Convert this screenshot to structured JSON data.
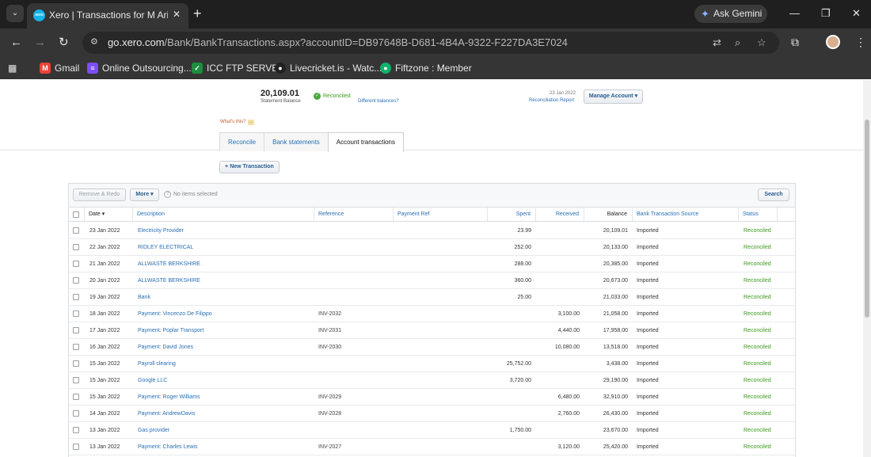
{
  "browser": {
    "tab_title": "Xero | Transactions for M Arif Ali",
    "favicon_text": "xero",
    "gemini_label": "Ask Gemini",
    "url_host": "go.xero.com",
    "url_path": "/Bank/BankTransactions.aspx?accountID=DB97648B-D681-4B4A-9322-F227DA3E7024",
    "bookmarks": [
      {
        "label": "Gmail",
        "icon": "gmail-icon",
        "color": "#ea4335",
        "glyph": "M"
      },
      {
        "label": "Online Outsourcing...",
        "icon": "list-icon",
        "color": "#7c4dff",
        "glyph": "≡"
      },
      {
        "label": "ICC FTP SERVER",
        "icon": "check-icon",
        "color": "#1e8e3e",
        "glyph": "✓"
      },
      {
        "label": "Livecricket.is - Watc...",
        "icon": "cricket-icon",
        "color": "#222222",
        "glyph": "●"
      },
      {
        "label": "Fiftzone : Member",
        "icon": "fiftzone-icon",
        "color": "#0fb36b",
        "glyph": "●"
      }
    ]
  },
  "summary": {
    "statement_balance": "20,109.01",
    "statement_balance_label": "Statement Balance",
    "reconciled_label": "Reconciled",
    "different_balances": "Different balances?",
    "report_date": "23 Jan 2022",
    "reconciliation_report": "Reconciliation Report",
    "manage_account": "Manage Account ▾",
    "whats_this": "What's this?"
  },
  "tabs": [
    "Reconcile",
    "Bank statements",
    "Account transactions"
  ],
  "new_transaction": "+ New Transaction",
  "toolbar": {
    "remove_redo": "Remove & Redo",
    "more": "More ▾",
    "no_items": "No items selected",
    "search": "Search"
  },
  "columns": {
    "date": "Date ▾",
    "description": "Description",
    "reference": "Reference",
    "payment_ref": "Payment Ref",
    "spent": "Spent",
    "received": "Received",
    "balance": "Balance",
    "source": "Bank Transaction Source",
    "status": "Status"
  },
  "rows": [
    {
      "date": "23 Jan 2022",
      "description": "Electricity Provider",
      "reference": "",
      "spent": "23.99",
      "received": "",
      "balance": "20,109.01",
      "source": "Imported",
      "status": "Reconciled"
    },
    {
      "date": "22 Jan 2022",
      "description": "RIDLEY ELECTRICAL",
      "reference": "",
      "spent": "252.00",
      "received": "",
      "balance": "20,133.00",
      "source": "Imported",
      "status": "Reconciled"
    },
    {
      "date": "21 Jan 2022",
      "description": "ALLWASTE BERKSHIRE",
      "reference": "",
      "spent": "288.00",
      "received": "",
      "balance": "20,385.00",
      "source": "Imported",
      "status": "Reconciled"
    },
    {
      "date": "20 Jan 2022",
      "description": "ALLWASTE BERKSHIRE",
      "reference": "",
      "spent": "360.00",
      "received": "",
      "balance": "20,673.00",
      "source": "Imported",
      "status": "Reconciled"
    },
    {
      "date": "19 Jan 2022",
      "description": "Bank",
      "reference": "",
      "spent": "25.00",
      "received": "",
      "balance": "21,033.00",
      "source": "Imported",
      "status": "Reconciled"
    },
    {
      "date": "18 Jan 2022",
      "description": "Payment: Vincenzo De Filippo",
      "reference": "INV-2032",
      "spent": "",
      "received": "3,100.00",
      "balance": "21,058.00",
      "source": "Imported",
      "status": "Reconciled"
    },
    {
      "date": "17 Jan 2022",
      "description": "Payment: Poplar Transport",
      "reference": "INV-2031",
      "spent": "",
      "received": "4,440.00",
      "balance": "17,958.00",
      "source": "Imported",
      "status": "Reconciled"
    },
    {
      "date": "16 Jan 2022",
      "description": "Payment: David Jones",
      "reference": "INV-2030",
      "spent": "",
      "received": "10,080.00",
      "balance": "13,518.00",
      "source": "Imported",
      "status": "Reconciled"
    },
    {
      "date": "15 Jan 2022",
      "description": "Payroll clearing",
      "reference": "",
      "spent": "25,752.00",
      "received": "",
      "balance": "3,438.00",
      "source": "Imported",
      "status": "Reconciled"
    },
    {
      "date": "15 Jan 2022",
      "description": "Google LLC",
      "reference": "",
      "spent": "3,720.00",
      "received": "",
      "balance": "29,190.00",
      "source": "Imported",
      "status": "Reconciled"
    },
    {
      "date": "15 Jan 2022",
      "description": "Payment: Roger Williams",
      "reference": "INV-2029",
      "spent": "",
      "received": "6,480.00",
      "balance": "32,910.00",
      "source": "Imported",
      "status": "Reconciled"
    },
    {
      "date": "14 Jan 2022",
      "description": "Payment: AndrewDavis",
      "reference": "INV-2028",
      "spent": "",
      "received": "2,760.00",
      "balance": "26,430.00",
      "source": "Imported",
      "status": "Reconciled"
    },
    {
      "date": "13 Jan 2022",
      "description": "Gas provider",
      "reference": "",
      "spent": "1,750.00",
      "received": "",
      "balance": "23,670.00",
      "source": "Imported",
      "status": "Reconciled"
    },
    {
      "date": "13 Jan 2022",
      "description": "Payment: Charles Lewis",
      "reference": "INV-2027",
      "spent": "",
      "received": "3,120.00",
      "balance": "25,420.00",
      "source": "Imported",
      "status": "Reconciled"
    }
  ]
}
